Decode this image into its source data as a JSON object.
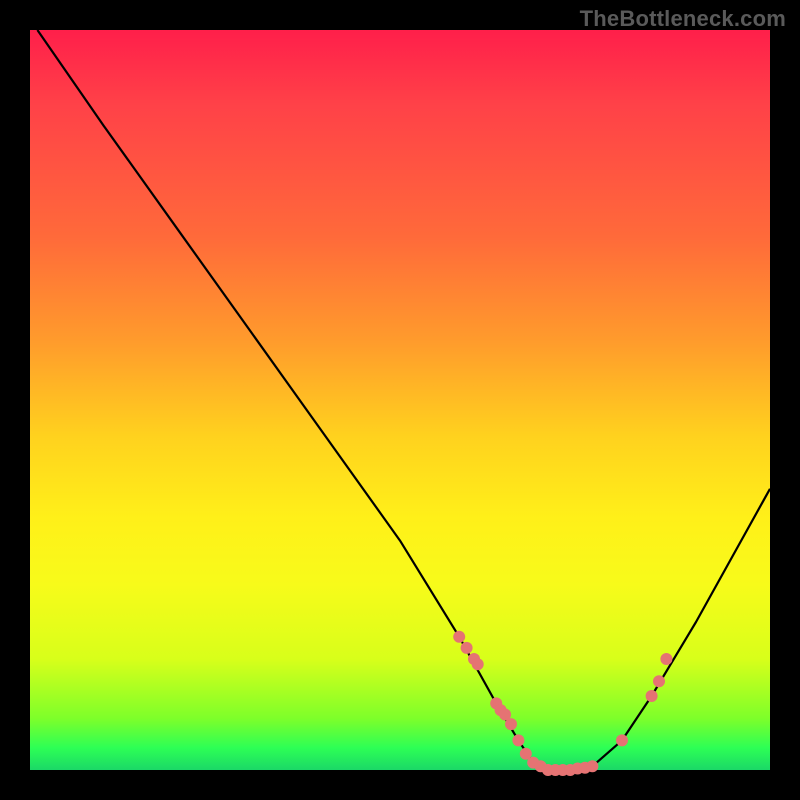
{
  "watermark": "TheBottleneck.com",
  "chart_data": {
    "type": "line",
    "title": "",
    "xlabel": "",
    "ylabel": "",
    "xlim": [
      0,
      100
    ],
    "ylim": [
      0,
      100
    ],
    "grid": false,
    "series": [
      {
        "name": "curve",
        "x": [
          1,
          10,
          20,
          30,
          40,
          50,
          58,
          63,
          66,
          68,
          70,
          73,
          76,
          80,
          84,
          90,
          100
        ],
        "y": [
          100,
          87,
          73,
          59,
          45,
          31,
          18,
          9,
          4,
          1,
          0,
          0,
          0.5,
          4,
          10,
          20,
          38
        ]
      }
    ],
    "scatter_points": {
      "name": "markers",
      "x": [
        58,
        59,
        60,
        60.5,
        63,
        63.6,
        64.2,
        65,
        66,
        67,
        68,
        69,
        70,
        71,
        72,
        73,
        74,
        75,
        76,
        80,
        84,
        85,
        86
      ],
      "y": [
        18,
        16.5,
        15,
        14.3,
        9,
        8.1,
        7.5,
        6.2,
        4,
        2.2,
        1,
        0.5,
        0,
        0,
        0,
        0,
        0.2,
        0.3,
        0.5,
        4,
        10,
        12,
        15
      ]
    },
    "colors": {
      "curve": "#000000",
      "markers": "#e57373",
      "gradient_top": "#ff1f4a",
      "gradient_mid": "#fff019",
      "gradient_bottom": "#1bd867",
      "background": "#000000"
    }
  }
}
